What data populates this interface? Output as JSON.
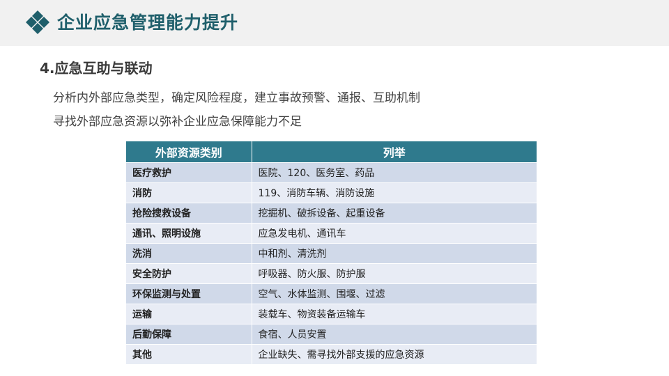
{
  "header": {
    "title": "企业应急管理能力提升",
    "logo_icon": "diamond-logo-icon",
    "accent_color": "#1f5f6b"
  },
  "section": {
    "title": "4.应急互助与联动",
    "lines": [
      "分析内外部应急类型，确定风险程度，建立事故预警、通报、互助机制",
      "寻找外部应急资源以弥补企业应急保障能力不足"
    ]
  },
  "table": {
    "header_color": "#2f7a8d",
    "columns": [
      "外部资源类别",
      "列举"
    ],
    "rows": [
      {
        "category": "医疗救护",
        "items": "医院、120、医务室、药品"
      },
      {
        "category": "消防",
        "items": "119、消防车辆、消防设施"
      },
      {
        "category": "抢险搜救设备",
        "items": "挖掘机、破拆设备、起重设备"
      },
      {
        "category": "通讯、照明设施",
        "items": "应急发电机、通讯车"
      },
      {
        "category": "洗消",
        "items": "中和剂、清洗剂"
      },
      {
        "category": "安全防护",
        "items": "呼吸器、防火服、防护服"
      },
      {
        "category": "环保监测与处置",
        "items": "空气、水体监测、围堰、过滤"
      },
      {
        "category": "运输",
        "items": "装载车、物资装备运输车"
      },
      {
        "category": "后勤保障",
        "items": "食宿、人员安置"
      },
      {
        "category": "其他",
        "items": "企业缺失、需寻找外部支援的应急资源"
      }
    ]
  }
}
